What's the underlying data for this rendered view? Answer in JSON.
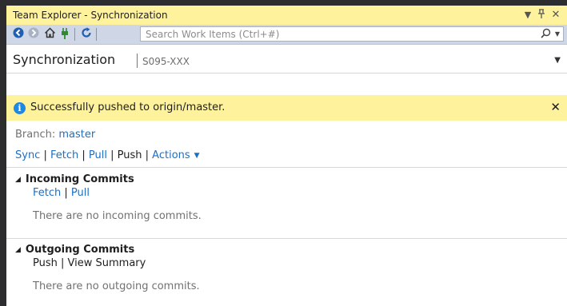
{
  "window": {
    "title": "Team Explorer - Synchronization",
    "controls": {
      "dropdown": "▾",
      "pin": "ᚡ",
      "close": "✕"
    }
  },
  "toolbar": {
    "icons": [
      "back-icon",
      "forward-icon",
      "home-icon",
      "connect-plug-icon",
      "refresh-icon"
    ],
    "search_placeholder": "Search Work Items (Ctrl+#)"
  },
  "header": {
    "title": "Synchronization",
    "repo": "S095-XXX"
  },
  "notification": {
    "message": "Successfully pushed to origin/master."
  },
  "branch": {
    "label": "Branch:",
    "name": "master"
  },
  "actions": {
    "sync": "Sync",
    "fetch": "Fetch",
    "pull": "Pull",
    "push": "Push",
    "actions": "Actions"
  },
  "incoming": {
    "title": "Incoming Commits",
    "fetch": "Fetch",
    "pull": "Pull",
    "message": "There are no incoming commits."
  },
  "outgoing": {
    "title": "Outgoing Commits",
    "push": "Push",
    "view_summary": "View Summary",
    "message": "There are no outgoing commits."
  },
  "colors": {
    "accent_yellow": "#fff29d",
    "link_blue": "#1e6fc2",
    "toolbar_bg": "#cfd6e5"
  }
}
